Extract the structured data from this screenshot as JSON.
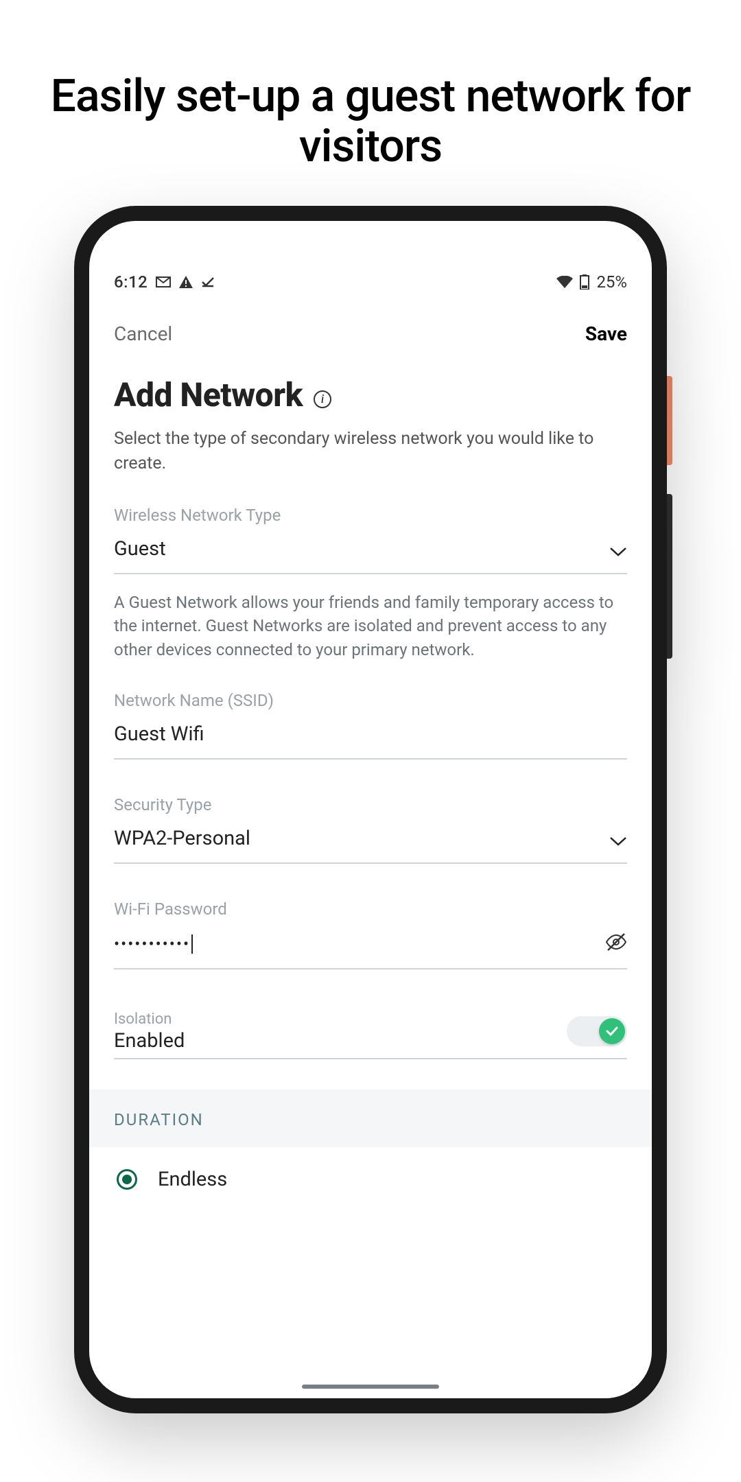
{
  "marketing": {
    "headline": "Easily set-up a guest network for visitors"
  },
  "status": {
    "time": "6:12",
    "battery": "25%"
  },
  "topbar": {
    "cancel": "Cancel",
    "save": "Save"
  },
  "page": {
    "title": "Add Network",
    "subtitle": "Select the type of secondary wireless network you would like to create."
  },
  "fields": {
    "type_label": "Wireless Network Type",
    "type_value": "Guest",
    "type_helper": "A Guest Network allows your friends and family temporary access to the internet. Guest Networks are isolated and prevent access to any other devices connected to your primary network.",
    "ssid_label": "Network Name (SSID)",
    "ssid_value": "Guest Wifi",
    "security_label": "Security Type",
    "security_value": "WPA2-Personal",
    "password_label": "Wi-Fi Password",
    "password_masked": "•••••••••••",
    "isolation_label": "Isolation",
    "isolation_value": "Enabled"
  },
  "duration": {
    "header": "DURATION",
    "option_endless": "Endless"
  }
}
